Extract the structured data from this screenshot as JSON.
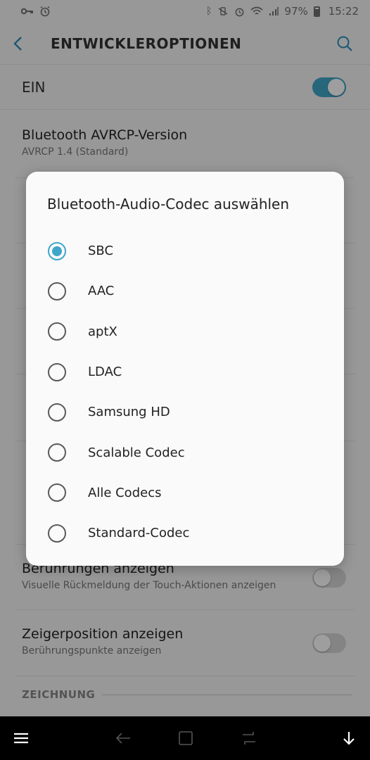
{
  "status_bar": {
    "battery_level": "97%",
    "time": "15:22"
  },
  "app_bar": {
    "title": "ENTWICKLEROPTIONEN"
  },
  "master_switch": {
    "label": "EIN",
    "enabled": true
  },
  "background_settings": {
    "avrcp_title": "Bluetooth AVRCP-Version",
    "avrcp_value": "AVRCP 1.4 (Standard)",
    "touches_title": "Berührungen anzeigen",
    "touches_summary": "Visuelle Rückmeldung der Touch-Aktionen anzeigen",
    "pointer_title": "Zeigerposition anzeigen",
    "pointer_summary": "Berührungspunkte anzeigen",
    "section_drawing": "ZEICHNUNG"
  },
  "dialog": {
    "title": "Bluetooth-Audio-Codec auswählen",
    "selected": "SBC",
    "options": [
      {
        "label": "SBC"
      },
      {
        "label": "AAC"
      },
      {
        "label": "aptX"
      },
      {
        "label": "LDAC"
      },
      {
        "label": "Samsung HD"
      },
      {
        "label": "Scalable Codec"
      },
      {
        "label": "Alle Codecs"
      },
      {
        "label": "Standard-Codec"
      }
    ]
  },
  "colors": {
    "accent": "#3fa6c9",
    "scrim": "rgba(0,0,0,0.38)"
  }
}
